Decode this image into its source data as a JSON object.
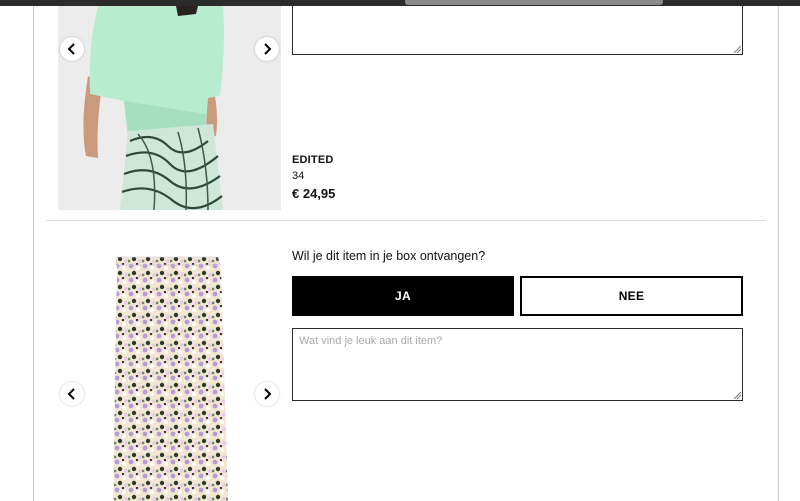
{
  "item1": {
    "brand": "EDITED",
    "size": "34",
    "price": "€ 24,95"
  },
  "item2": {
    "question": "Wil je dit item in je box ontvangen?",
    "yes_label": "JA",
    "no_label": "NEE",
    "comment_placeholder": "Wat vind je leuk aan dit item?"
  },
  "colors": {
    "accent": "#000000",
    "divider": "#d9dbe8",
    "frame": "#c9cbe0"
  }
}
